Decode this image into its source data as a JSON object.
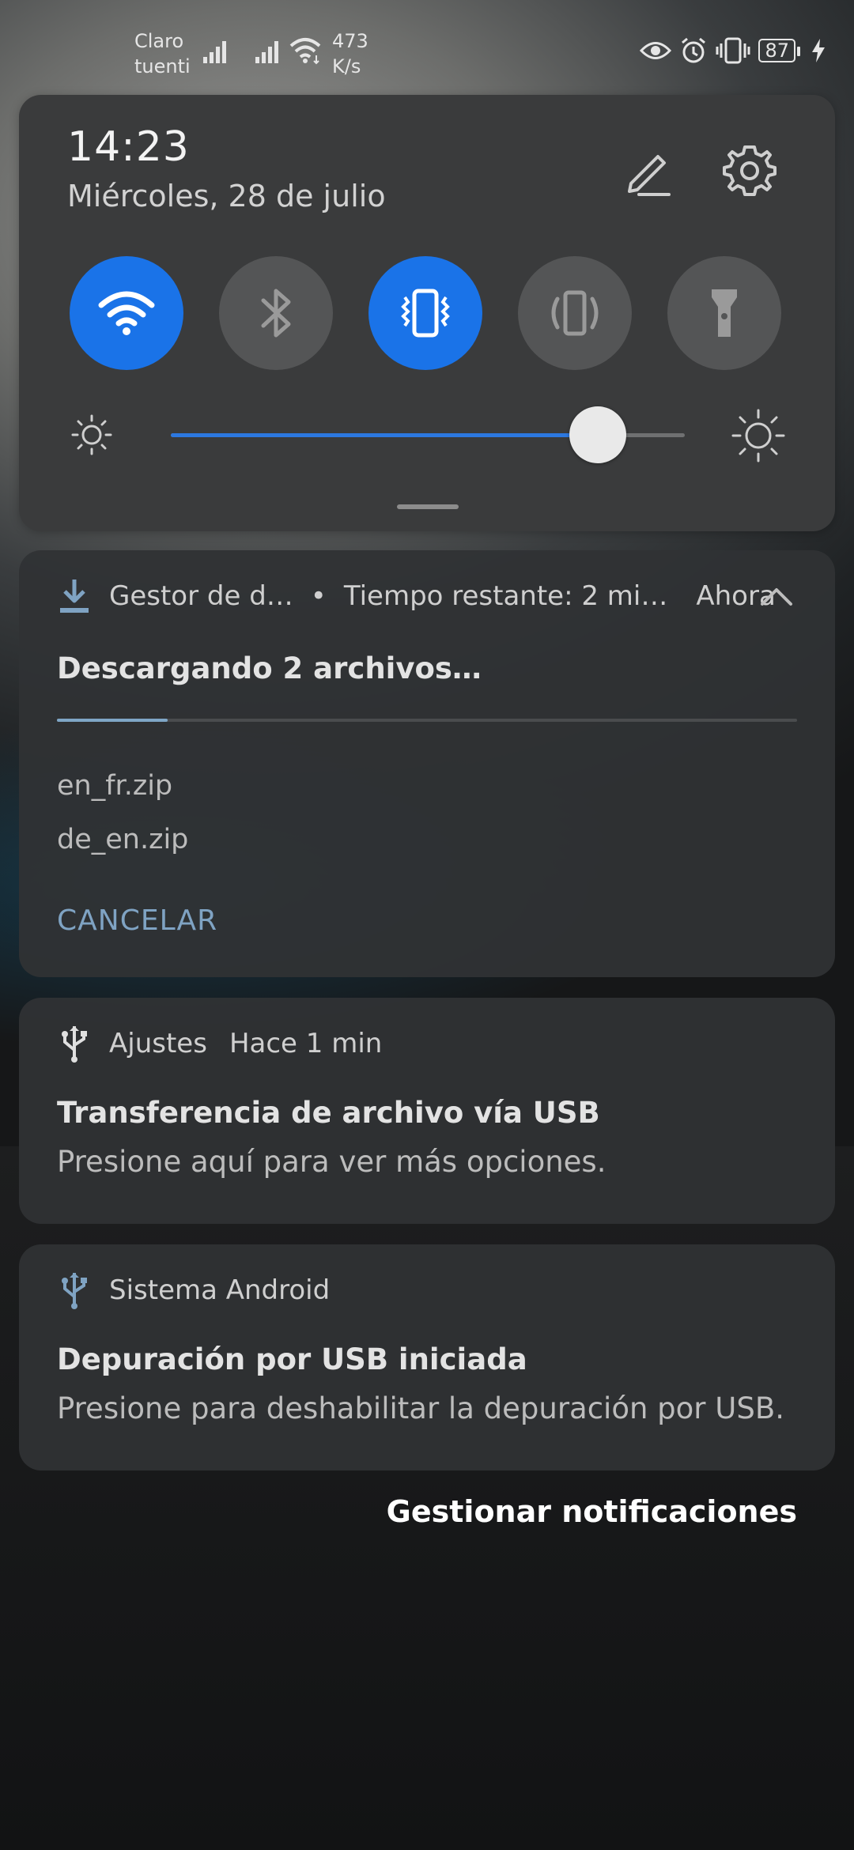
{
  "status_bar": {
    "carrier_1": "Claro",
    "carrier_2": "tuenti",
    "speed_value": "473",
    "speed_unit": "K/s",
    "battery": "87",
    "icons": [
      "signal-icon",
      "signal-icon",
      "wifi-icon",
      "eye-icon",
      "alarm-icon",
      "vibrate-icon",
      "battery-icon",
      "charging-icon"
    ]
  },
  "quick_settings": {
    "time": "14:23",
    "date": "Miércoles, 28 de julio",
    "toggles": [
      {
        "name": "wifi",
        "active": true
      },
      {
        "name": "bluetooth",
        "active": false
      },
      {
        "name": "vibrate",
        "active": true
      },
      {
        "name": "auto-rotate",
        "active": false
      },
      {
        "name": "flashlight",
        "active": false
      }
    ],
    "brightness_level": 0.83,
    "accent_color": "#1a73e8"
  },
  "notifications": {
    "download": {
      "app": "Gestor de d…",
      "separator": "•",
      "subtext": "Tiempo restante: 2 mi…",
      "time": "Ahora",
      "title": "Descargando 2 archivos…",
      "progress": 0.15,
      "files": [
        "en_fr.zip",
        "de_en.zip"
      ],
      "action": "CANCELAR"
    },
    "usb_transfer": {
      "app": "Ajustes",
      "time": "Hace 1 min",
      "title": "Transferencia de archivo vía USB",
      "body": "Presione aquí para ver más opciones."
    },
    "usb_debug": {
      "app": "Sistema Android",
      "title": "Depuración por USB iniciada",
      "body": "Presione para deshabilitar la depuración por USB."
    }
  },
  "manage_label": "Gestionar notificaciones"
}
